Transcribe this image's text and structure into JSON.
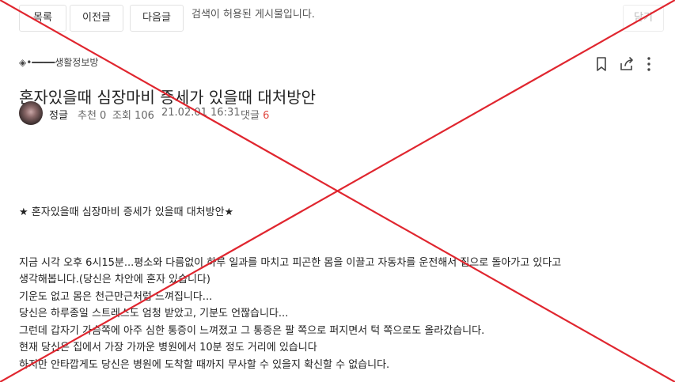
{
  "toolbar": {
    "list_label": "목록",
    "prev_label": "이전글",
    "next_label": "다음글",
    "notice": "검색이 허용된 게시물입니다.",
    "close_label": "닫기"
  },
  "post": {
    "category": "◈•━━━━생활정보방",
    "title": "혼자있을때 심장마비 증세가 있을때 대처방안",
    "author": "정글",
    "recommend": "추천 0",
    "views": "조회 106",
    "date": "21.02.01 16:31",
    "comment_label": "댓글",
    "comment_count": "6"
  },
  "body": {
    "subtitle": "★ 혼자있을때 심장마비 증세가 있을때 대처방안★",
    "lines": [
      "지금 시각 오후 6시15분...평소와 다름없이 하루 일과를 마치고 피곤한 몸을 이끌고 자동차를 운전해서 집으로 돌아가고 있다고",
      "생각해봅니다.(당신은 차안에 혼자 있습니다)",
      "기운도 없고 몸은 천근만근처럼 느껴집니다...",
      "당신은 하루종일 스트레스도 엄청 받았고, 기분도 언짢습니다...",
      "그런데 갑자기 가슴쪽에 아주 심한 통증이 느껴졌고  그 통증은 팔 쪽으로 퍼지면서  턱 쪽으로도 올라갔습니다.",
      "현재 당신은 집에서 가장 가까운 병원에서  10분 정도 거리에 있습니다",
      "하지만 안타깝게도 당신은 병원에 도착할 때까지 무사할 수 있을지 확신할 수 없습니다."
    ]
  },
  "icons": [
    "bookmark-icon",
    "share-icon",
    "more-icon"
  ],
  "colors": {
    "cross": "#e0262f",
    "comment_count": "#e0473f"
  }
}
